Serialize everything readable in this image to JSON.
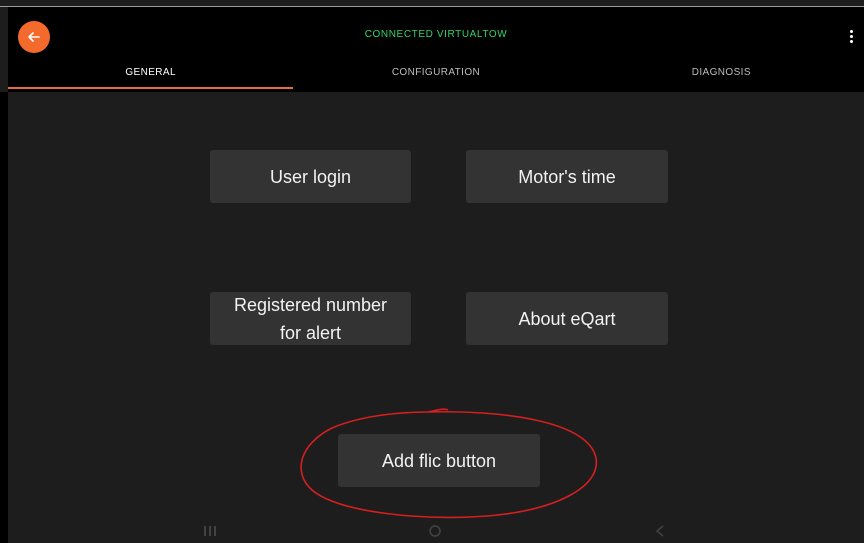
{
  "header": {
    "title": "CONNECTED VIRTUALTOW",
    "back_icon": "arrow-left-icon",
    "menu_icon": "more-vertical-icon",
    "accent_color": "#f36a2c",
    "title_color": "#2fd46b"
  },
  "tabs": [
    {
      "label": "GENERAL",
      "active": true
    },
    {
      "label": "CONFIGURATION",
      "active": false
    },
    {
      "label": "DIAGNOSIS",
      "active": false
    }
  ],
  "buttons": {
    "user_login": "User login",
    "motors_time": "Motor's time",
    "registered_number": "Registered number for alert",
    "about": "About eQart",
    "add_flic": "Add flic button"
  },
  "annotation": {
    "color": "#d61f1f"
  },
  "navbar": {
    "icons": [
      "recent-apps-icon",
      "home-icon",
      "back-nav-icon"
    ]
  }
}
